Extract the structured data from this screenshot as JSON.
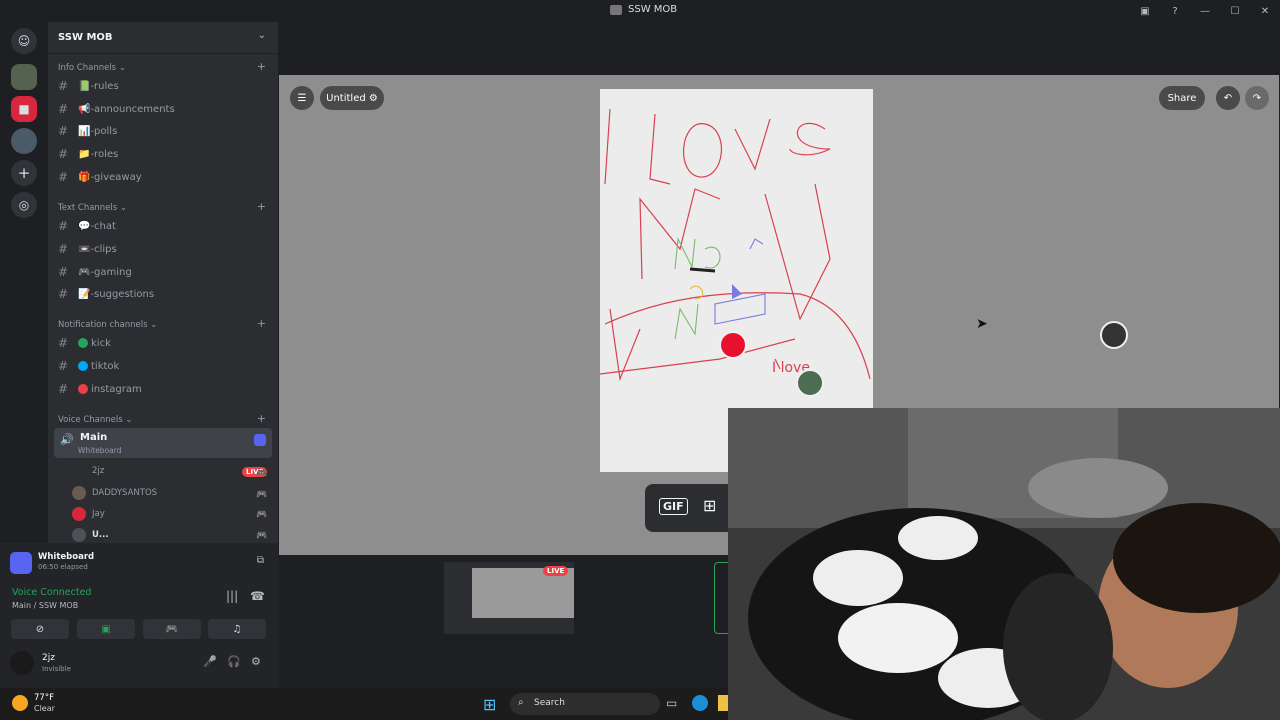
{
  "window": {
    "title": "SSW MOB"
  },
  "guild": {
    "name": "SSW MOB"
  },
  "categories": [
    {
      "label": "Info Channels",
      "channels": [
        {
          "name": "📗-rules",
          "color": "#3ba55c"
        },
        {
          "name": "📢-announcements",
          "color": "#ed4245"
        },
        {
          "name": "📊-polls",
          "color": "#5865f2"
        },
        {
          "name": "📁-roles",
          "color": "#f0b232"
        },
        {
          "name": "🎁-giveaway",
          "color": "#f0b232"
        }
      ]
    },
    {
      "label": "Text Channels",
      "channels": [
        {
          "name": "💬-chat",
          "color": "#dbdee1"
        },
        {
          "name": "📼-clips",
          "color": "#949ba4"
        },
        {
          "name": "🎮-gaming",
          "color": "#5865f2"
        },
        {
          "name": "📝-suggestions",
          "color": "#dbdee1"
        }
      ]
    },
    {
      "label": "Notification channels",
      "channels": [
        {
          "name": "kick",
          "color": "#23a55a"
        },
        {
          "name": "tiktok",
          "color": "#00a8fc"
        },
        {
          "name": "instagram",
          "color": "#ed4245"
        }
      ]
    },
    {
      "label": "Voice Channels",
      "channels": []
    }
  ],
  "voice": {
    "channel": "Main",
    "activity": "Whiteboard",
    "users": [
      "2jz",
      "DADDYSANTOS",
      "Jay",
      "U..."
    ],
    "live_label": "LIVE"
  },
  "panel": {
    "activity_title": "Whiteboard",
    "activity_elapsed": "06:50 elapsed",
    "status": "Voice Connected",
    "room": "Main / SSW MOB",
    "user_name": "2jz",
    "user_status": "Invisible"
  },
  "whiteboard": {
    "doc_title": "Untitled",
    "share_label": "Share",
    "gif_label": "GIF",
    "drawing_text": "I love"
  },
  "stream_thumb": {
    "live_label": "LIVE"
  },
  "taskbar": {
    "temp": "77°F",
    "condition": "Clear",
    "search": "Search"
  }
}
